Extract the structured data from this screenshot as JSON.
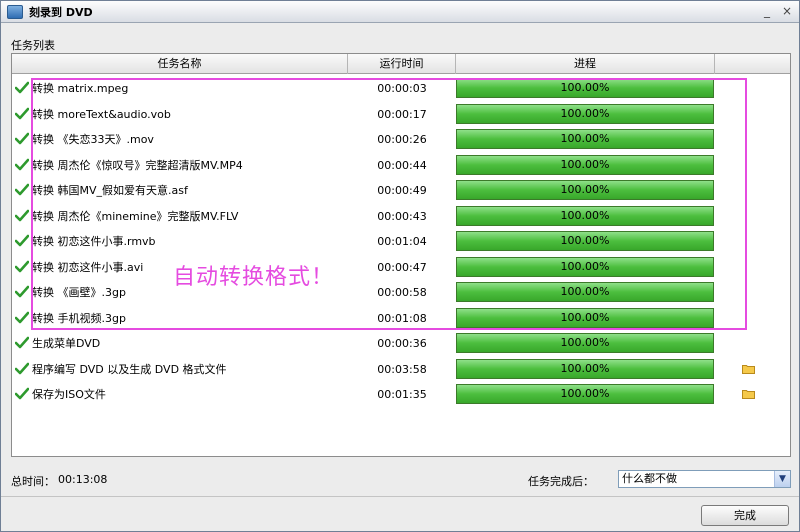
{
  "window": {
    "title": "刻录到 DVD",
    "minimize": "_",
    "close": "×"
  },
  "section_label": "任务列表",
  "columns": {
    "name": "任务名称",
    "time": "运行时间",
    "progress": "进程"
  },
  "rows": [
    {
      "name": "转换 matrix.mpeg",
      "time": "00:00:03",
      "progress": "100.00%",
      "folder": false
    },
    {
      "name": "转换 moreText&audio.vob",
      "time": "00:00:17",
      "progress": "100.00%",
      "folder": false
    },
    {
      "name": "转换 《失恋33天》.mov",
      "time": "00:00:26",
      "progress": "100.00%",
      "folder": false
    },
    {
      "name": "转换 周杰伦《惊叹号》完整超清版MV.MP4",
      "time": "00:00:44",
      "progress": "100.00%",
      "folder": false
    },
    {
      "name": "转换 韩国MV_假如爱有天意.asf",
      "time": "00:00:49",
      "progress": "100.00%",
      "folder": false
    },
    {
      "name": "转换 周杰伦《minemine》完整版MV.FLV",
      "time": "00:00:43",
      "progress": "100.00%",
      "folder": false
    },
    {
      "name": "转换 初恋这件小事.rmvb",
      "time": "00:01:04",
      "progress": "100.00%",
      "folder": false
    },
    {
      "name": "转换 初恋这件小事.avi",
      "time": "00:00:47",
      "progress": "100.00%",
      "folder": false
    },
    {
      "name": "转换 《画壁》.3gp",
      "time": "00:00:58",
      "progress": "100.00%",
      "folder": false
    },
    {
      "name": "转换 手机视频.3gp",
      "time": "00:01:08",
      "progress": "100.00%",
      "folder": false
    },
    {
      "name": "生成菜单DVD",
      "time": "00:00:36",
      "progress": "100.00%",
      "folder": false
    },
    {
      "name": "程序编写 DVD 以及生成 DVD 格式文件",
      "time": "00:03:58",
      "progress": "100.00%",
      "folder": true
    },
    {
      "name": "保存为ISO文件",
      "time": "00:01:35",
      "progress": "100.00%",
      "folder": true
    }
  ],
  "annotation": "自动转换格式！",
  "total": {
    "label": "总时间：",
    "value": "00:13:08"
  },
  "after_complete": {
    "label": "任务完成后：",
    "selected": "什么都不做"
  },
  "done_button": "完成",
  "colors": {
    "progress_fill": "#4cbe3e",
    "annotation": "#e54be0",
    "check": "#2e9a2e"
  }
}
